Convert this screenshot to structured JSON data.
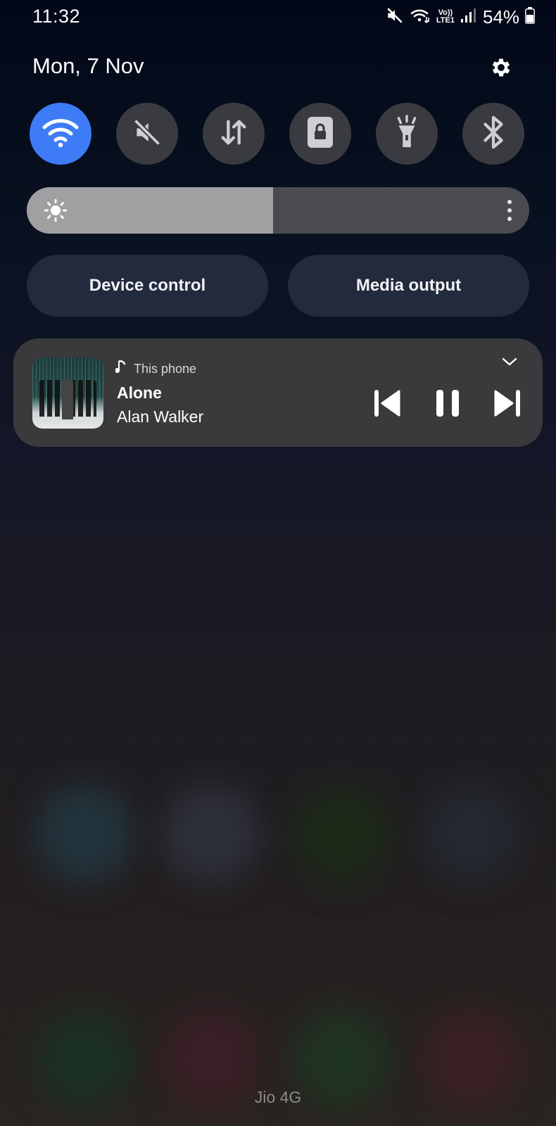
{
  "status_bar": {
    "time": "11:32",
    "network_top": "Vo))",
    "network_bottom": "LTE1",
    "battery": "54%",
    "icons": [
      "mute-icon",
      "wifi-icon",
      "volte-icon",
      "signal-icon",
      "battery-icon"
    ]
  },
  "header": {
    "date": "Mon, 7 Nov",
    "settings_icon": "gear-icon"
  },
  "quick_tiles": [
    {
      "name": "wifi",
      "icon": "wifi-icon",
      "active": true
    },
    {
      "name": "sound",
      "icon": "mute-icon",
      "active": false
    },
    {
      "name": "mobile-data",
      "icon": "data-arrows-icon",
      "active": false
    },
    {
      "name": "rotation-lock",
      "icon": "lock-icon",
      "active": false
    },
    {
      "name": "flashlight",
      "icon": "flashlight-icon",
      "active": false
    },
    {
      "name": "bluetooth",
      "icon": "bluetooth-icon",
      "active": false
    }
  ],
  "brightness": {
    "level": 0.49,
    "icon": "sun-icon"
  },
  "buttons": {
    "device_control": "Device control",
    "media_output": "Media output"
  },
  "media": {
    "source": "This phone",
    "title": "Alone",
    "artist": "Alan Walker",
    "controls": [
      "previous-icon",
      "pause-icon",
      "next-icon"
    ]
  },
  "footer": {
    "carrier": "Jio 4G"
  },
  "colors": {
    "accent": "#3e7bf6",
    "tile_inactive": "#3a3b40",
    "pill_bg": "#222a3d",
    "card_bg": "#3a3a3d"
  }
}
